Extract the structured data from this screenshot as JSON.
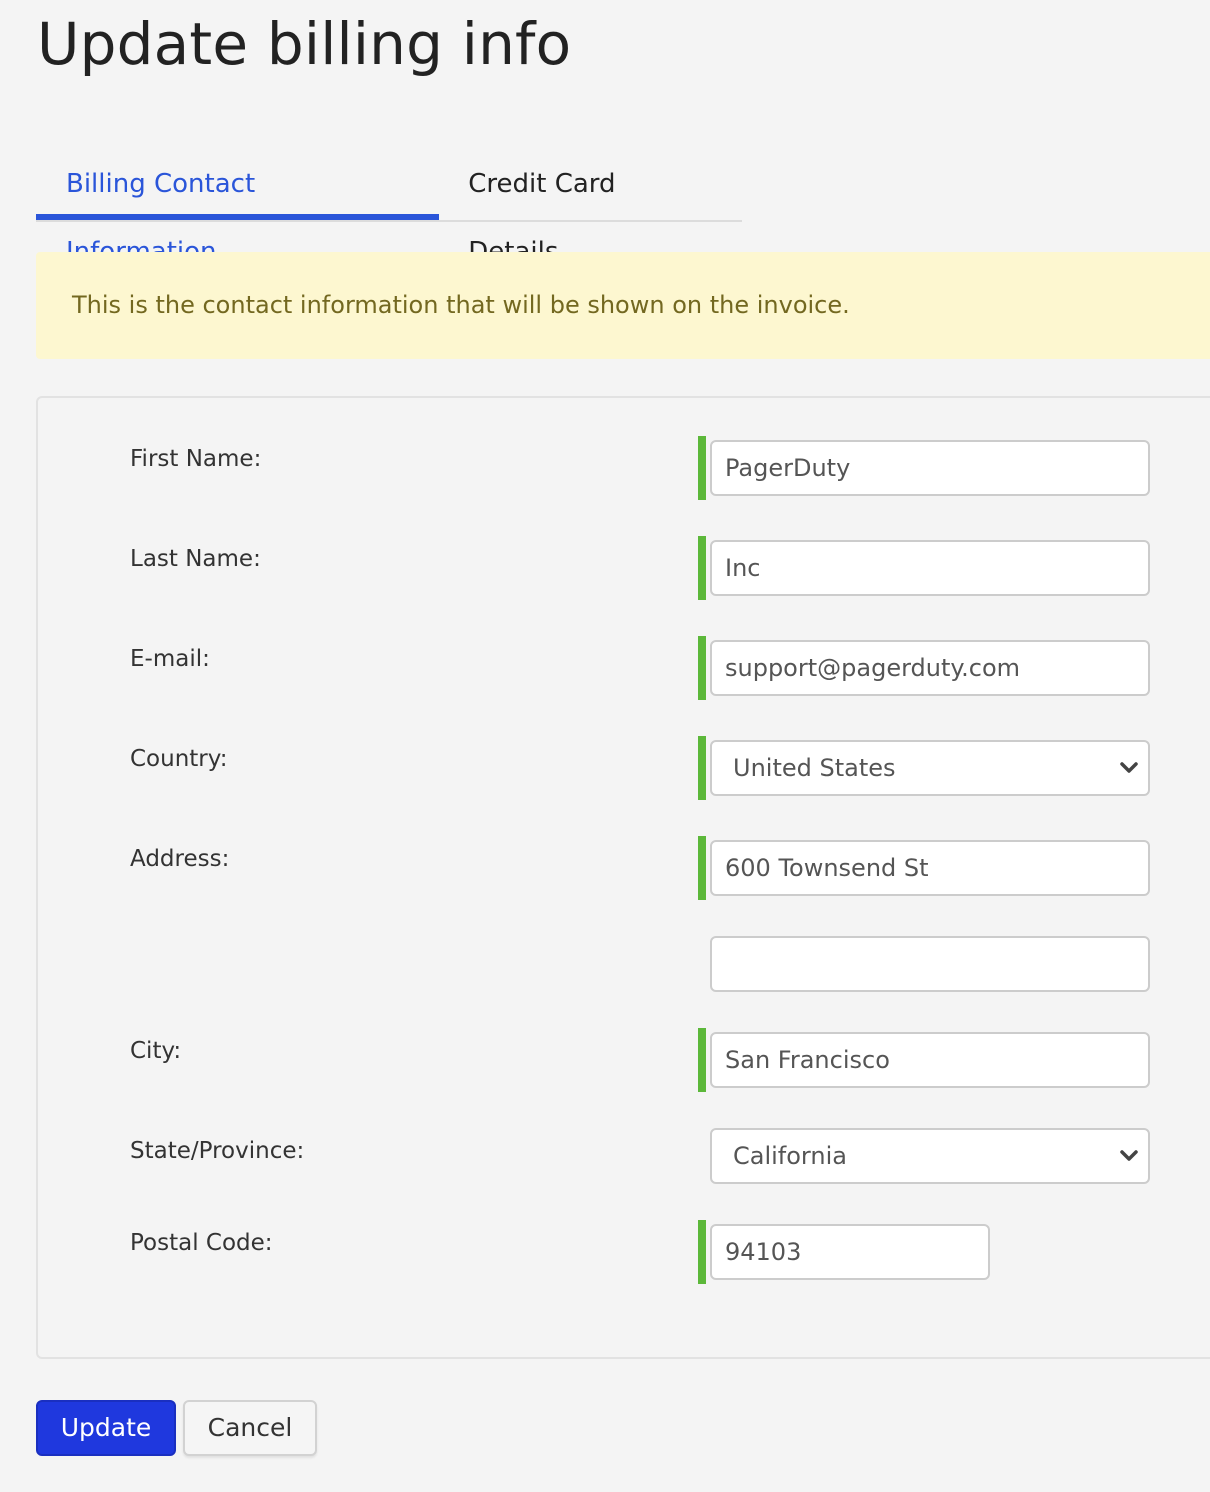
{
  "page": {
    "title": "Update billing info"
  },
  "tabs": [
    {
      "label": "Billing Contact Information",
      "active": true
    },
    {
      "label": "Credit Card Details",
      "active": false
    }
  ],
  "notice": {
    "text": "This is the contact information that will be shown on the invoice."
  },
  "form": {
    "first_name": {
      "label": "First Name:",
      "value": "PagerDuty",
      "required": true
    },
    "last_name": {
      "label": "Last Name:",
      "value": "Inc",
      "required": true
    },
    "email": {
      "label": "E-mail:",
      "value": "support@pagerduty.com",
      "required": true
    },
    "country": {
      "label": "Country:",
      "value": "United States",
      "required": true
    },
    "address": {
      "label": "Address:",
      "value": "600 Townsend St",
      "required": true
    },
    "address2": {
      "value": "",
      "required": false
    },
    "city": {
      "label": "City:",
      "value": "San Francisco",
      "required": true
    },
    "state": {
      "label": "State/Province:",
      "value": "California",
      "required": false
    },
    "postal_code": {
      "label": "Postal Code:",
      "value": "94103",
      "required": true
    }
  },
  "actions": {
    "update_label": "Update",
    "cancel_label": "Cancel"
  },
  "colors": {
    "accent": "#2a55d9",
    "primary_button": "#1f38de",
    "required_indicator": "#5cb83a",
    "notice_bg": "#fdf7d0",
    "notice_text": "#736820"
  }
}
